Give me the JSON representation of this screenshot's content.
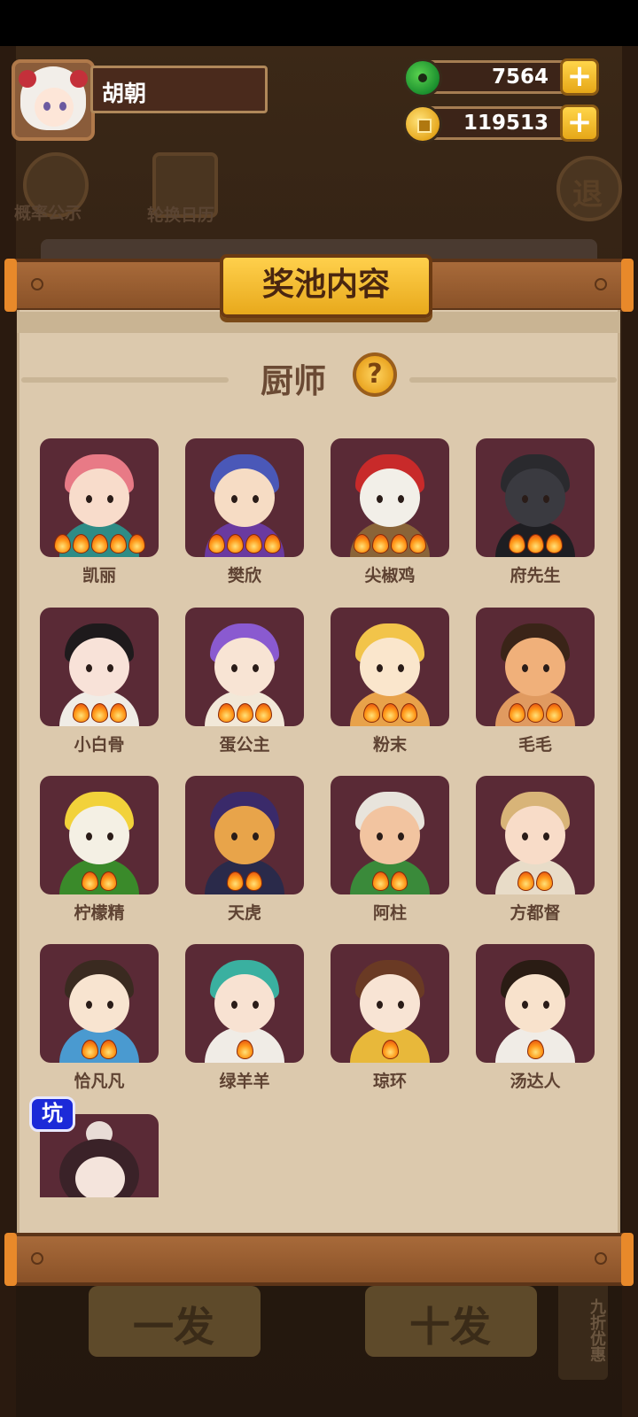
{
  "player": {
    "name": "胡朝"
  },
  "currencies": {
    "jade": "7564",
    "coins": "119513"
  },
  "background": {
    "probability_label": "概率公示",
    "rotation_label": "轮换日历",
    "exit_label": "退",
    "single_draw_label": "一发",
    "ten_draw_label": "十发",
    "discount_label": "九折优惠"
  },
  "panel": {
    "title": "奖池内容",
    "section_title": "厨师",
    "help_glyph": "?",
    "badge_label": "坑"
  },
  "chefs": [
    {
      "name": "凯丽",
      "stars": 5,
      "hair": "#e87a86",
      "skin": "#f8dccb",
      "outfit": "#2e8c86"
    },
    {
      "name": "樊欣",
      "stars": 4,
      "hair": "#4a58b8",
      "skin": "#f6dcc4",
      "outfit": "#6a3aa0"
    },
    {
      "name": "尖椒鸡",
      "stars": 4,
      "hair": "#c82a2a",
      "skin": "#f2efe8",
      "outfit": "#8a6438"
    },
    {
      "name": "府先生",
      "stars": 3,
      "hair": "#2a2a2e",
      "skin": "#3a3a40",
      "outfit": "#1e1e22"
    },
    {
      "name": "小白骨",
      "stars": 3,
      "hair": "#1e1a1c",
      "skin": "#f8e2d8",
      "outfit": "#f0ece6"
    },
    {
      "name": "蛋公主",
      "stars": 3,
      "hair": "#8a5ad0",
      "skin": "#f8e4d4",
      "outfit": "#f2e8d8"
    },
    {
      "name": "粉末",
      "stars": 3,
      "hair": "#f2c44a",
      "skin": "#fae6cc",
      "outfit": "#e8a24a"
    },
    {
      "name": "毛毛",
      "stars": 3,
      "hair": "#3a2418",
      "skin": "#f0b07a",
      "outfit": "#e09a60"
    },
    {
      "name": "柠檬精",
      "stars": 2,
      "hair": "#f2d23a",
      "skin": "#f4f0e4",
      "outfit": "#3a8a2a"
    },
    {
      "name": "天虎",
      "stars": 2,
      "hair": "#3a2a6a",
      "skin": "#e8a44a",
      "outfit": "#2a2a4a"
    },
    {
      "name": "阿柱",
      "stars": 2,
      "hair": "#e8e4dc",
      "skin": "#f2c4a0",
      "outfit": "#3a8a3a"
    },
    {
      "name": "方都督",
      "stars": 2,
      "hair": "#d8b478",
      "skin": "#f8dcc8",
      "outfit": "#e8dcc8"
    },
    {
      "name": "恰凡凡",
      "stars": 2,
      "hair": "#3a2a20",
      "skin": "#f8e4d0",
      "outfit": "#4a9ad0"
    },
    {
      "name": "绿羊羊",
      "stars": 1,
      "hair": "#3ab0a0",
      "skin": "#f8e2d2",
      "outfit": "#f0ece6"
    },
    {
      "name": "琼环",
      "stars": 1,
      "hair": "#6a3a24",
      "skin": "#f8e4d4",
      "outfit": "#e8b83a"
    },
    {
      "name": "汤达人",
      "stars": 1,
      "hair": "#2a1c14",
      "skin": "#f8e2cc",
      "outfit": "#f0ece6"
    }
  ]
}
